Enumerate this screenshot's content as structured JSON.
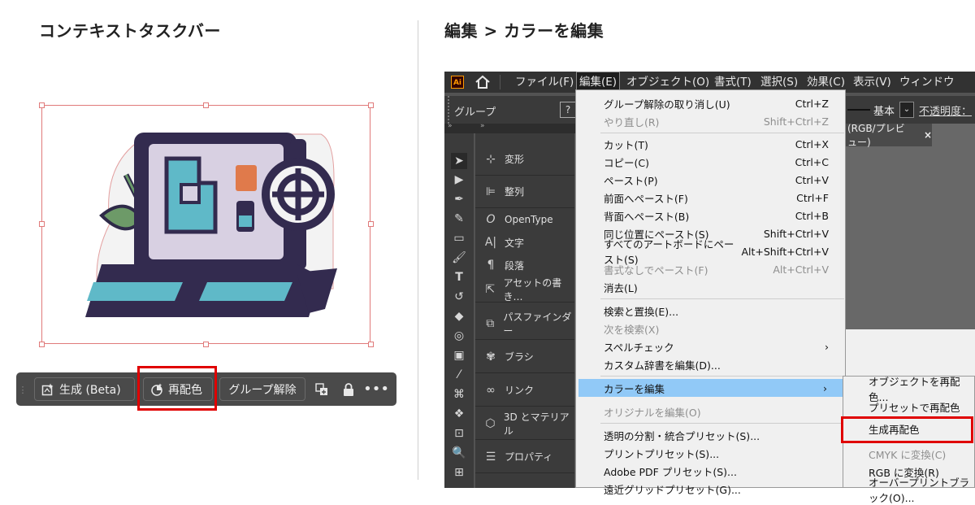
{
  "left_heading": "コンテキストタスクバー",
  "right_heading": "編集 > カラーを編集",
  "context_bar": {
    "generate_label": "生成 (Beta)",
    "recolor_label": "再配色",
    "ungroup_label": "グループ解除"
  },
  "app": {
    "logo": "Ai",
    "menus": [
      "ファイル(F)",
      "編集(E)",
      "オブジェクト(O)",
      "書式(T)",
      "選択(S)",
      "効果(C)",
      "表示(V)",
      "ウィンドウ(W)"
    ],
    "control_bar": {
      "group_label": "グループ",
      "help_glyph": "?",
      "stroke_profile": "基本",
      "opacity_label": "不透明度："
    },
    "doc_tab": {
      "title": "(RGB/プレビュー)",
      "close": "×"
    },
    "panel_items": [
      "変形",
      "整列",
      "OpenType",
      "文字",
      "段落",
      "アセットの書き…",
      "パスファインダー",
      "ブラシ",
      "リンク",
      "3D とマテリアル",
      "プロパティ"
    ]
  },
  "edit_menu": [
    {
      "label": "グループ解除の取り消し(U)",
      "shortcut": "Ctrl+Z",
      "disabled": false
    },
    {
      "label": "やり直し(R)",
      "shortcut": "Shift+Ctrl+Z",
      "disabled": true
    },
    {
      "label": "カット(T)",
      "shortcut": "Ctrl+X",
      "disabled": false
    },
    {
      "label": "コピー(C)",
      "shortcut": "Ctrl+C",
      "disabled": false
    },
    {
      "label": "ペースト(P)",
      "shortcut": "Ctrl+V",
      "disabled": false
    },
    {
      "label": "前面へペースト(F)",
      "shortcut": "Ctrl+F",
      "disabled": false
    },
    {
      "label": "背面へペースト(B)",
      "shortcut": "Ctrl+B",
      "disabled": false
    },
    {
      "label": "同じ位置にペースト(S)",
      "shortcut": "Shift+Ctrl+V",
      "disabled": false
    },
    {
      "label": "すべてのアートボードにペースト(S)",
      "shortcut": "Alt+Shift+Ctrl+V",
      "disabled": false
    },
    {
      "label": "書式なしでペースト(F)",
      "shortcut": "Alt+Ctrl+V",
      "disabled": true
    },
    {
      "label": "消去(L)",
      "shortcut": "",
      "disabled": false
    },
    {
      "label": "検索と置換(E)...",
      "shortcut": "",
      "disabled": false
    },
    {
      "label": "次を検索(X)",
      "shortcut": "",
      "disabled": true
    },
    {
      "label": "スペルチェック",
      "shortcut": "›",
      "disabled": false
    },
    {
      "label": "カスタム辞書を編集(D)...",
      "shortcut": "",
      "disabled": false
    },
    {
      "label": "カラーを編集",
      "shortcut": "›",
      "disabled": false
    },
    {
      "label": "オリジナルを編集(O)",
      "shortcut": "",
      "disabled": true
    },
    {
      "label": "透明の分割・統合プリセット(S)...",
      "shortcut": "",
      "disabled": false
    },
    {
      "label": "プリントプリセット(S)...",
      "shortcut": "",
      "disabled": false
    },
    {
      "label": "Adobe PDF プリセット(S)...",
      "shortcut": "",
      "disabled": false
    },
    {
      "label": "遠近グリッドプリセット(G)...",
      "shortcut": "",
      "disabled": false
    }
  ],
  "color_submenu": [
    {
      "label": "オブジェクトを再配色...",
      "disabled": false
    },
    {
      "label": "プリセットで再配色",
      "disabled": false
    },
    {
      "label": "生成再配色",
      "disabled": false
    },
    {
      "label": "CMYK に変換(C)",
      "disabled": true
    },
    {
      "label": "RGB に変換(R)",
      "disabled": false
    },
    {
      "label": "オーバープリントブラック(O)...",
      "disabled": false
    }
  ],
  "colors": {
    "highlight": "#e00000",
    "menu_selected": "#91c9f7",
    "illustration_navy": "#332b4f",
    "illustration_cyan": "#5fb9c8",
    "illustration_orange": "#e07a4b",
    "selection_bbox": "#e07a7a"
  }
}
